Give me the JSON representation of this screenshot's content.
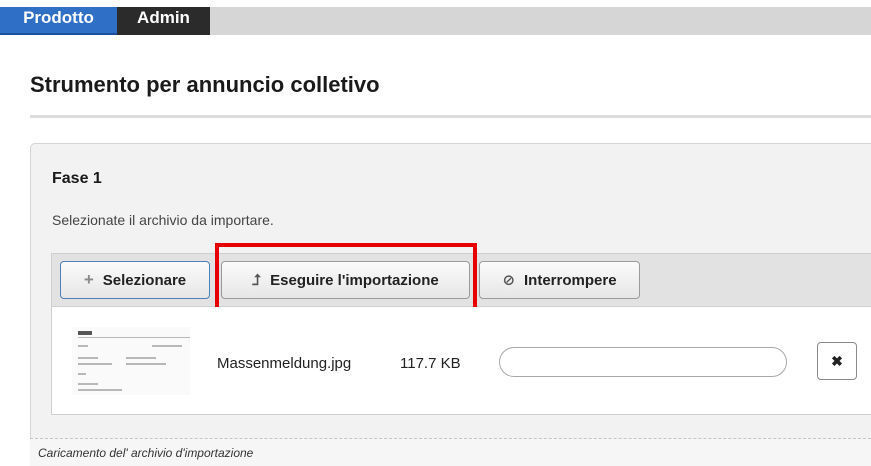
{
  "tabs": [
    {
      "label": "Prodotto",
      "active": true
    },
    {
      "label": "Admin",
      "active": false
    }
  ],
  "page": {
    "title": "Strumento per annuncio colletivo"
  },
  "step": {
    "title": "Fase 1",
    "description": "Selezionate il archivio da importare."
  },
  "toolbar": {
    "select_label": "Selezionare",
    "select_icon": "plus-icon",
    "import_label": "Eseguire l'importazione",
    "import_icon": "upload-arrow-icon",
    "stop_label": "Interrompere",
    "stop_icon": "cancel-circle-icon"
  },
  "file": {
    "name": "Massenmeldung.jpg",
    "size": "117.7 KB",
    "progress_percent": 0,
    "remove_icon": "close-icon"
  },
  "status": {
    "text": "Caricamento del' archivio d'importazione"
  },
  "colors": {
    "tab_active": "#2f6fc6",
    "tab_dark": "#2b2b2b",
    "highlight": "#e60000"
  }
}
